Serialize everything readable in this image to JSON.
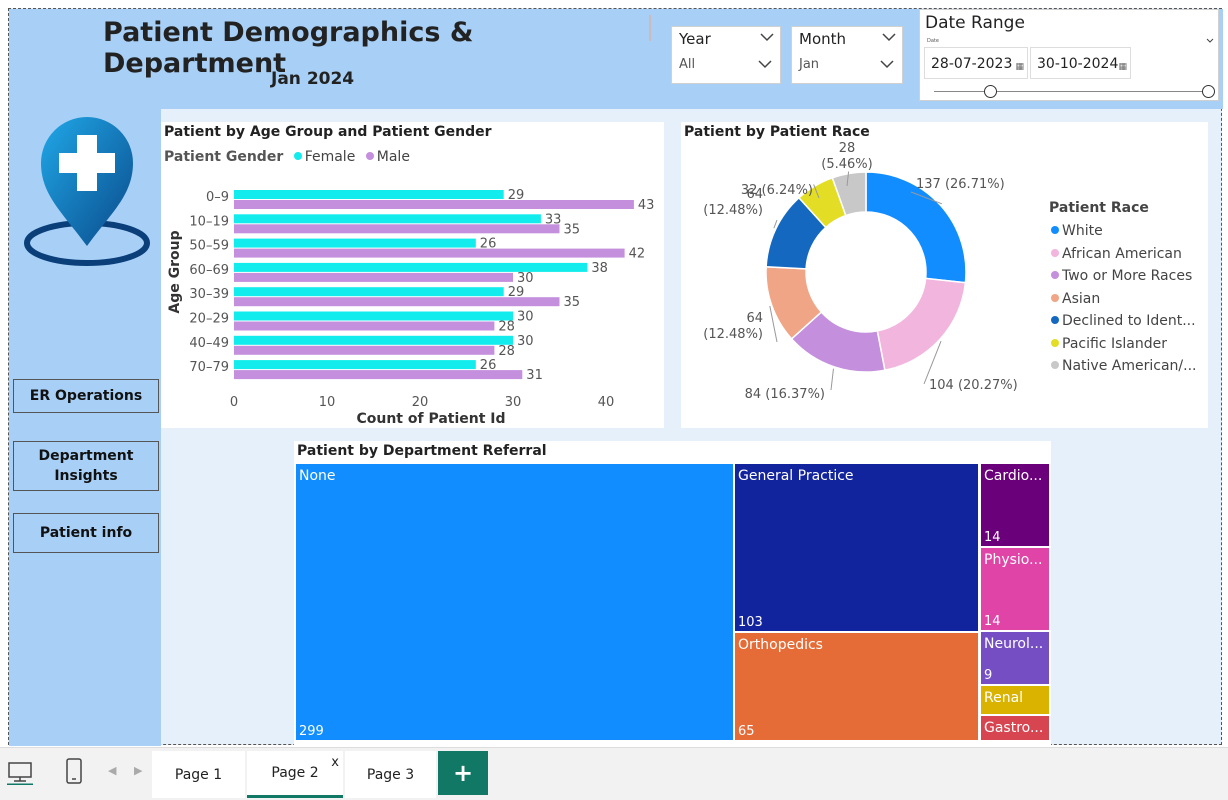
{
  "header": {
    "title": "Patient Demographics & Department",
    "subtitle": "Jan 2024"
  },
  "filters": {
    "year": {
      "label": "Year",
      "value": "All"
    },
    "month": {
      "label": "Month",
      "value": "Jan"
    },
    "date_range": {
      "label": "Date Range",
      "small_label": "Date",
      "start": "28-07-2023",
      "end": "30-10-2024",
      "slider_start": 0.0,
      "slider_end": 1.0
    }
  },
  "nav": {
    "er_operations": "ER Operations",
    "department_insights_line1": "Department",
    "department_insights_line2": "Insights",
    "patient_info": "Patient info"
  },
  "colors": {
    "female": "#12ecec",
    "male": "#c48fdc",
    "header_band": "#a8d0f7"
  },
  "age_chart": {
    "title": "Patient by Age Group and Patient Gender",
    "legend_title": "Patient Gender",
    "female_label": "Female",
    "male_label": "Male"
  },
  "race_chart": {
    "title": "Patient by Patient Race",
    "legend_title": "Patient Race"
  },
  "dept_chart": {
    "title": "Patient by Department Referral"
  },
  "chart_data": [
    {
      "type": "bar",
      "orientation": "horizontal",
      "title": "Patient by Age Group and Patient Gender",
      "xlabel": "Count of Patient Id",
      "ylabel": "Age Group",
      "categories": [
        "0–9",
        "10–19",
        "50–59",
        "60–69",
        "30–39",
        "20–29",
        "40–49",
        "70–79"
      ],
      "series": [
        {
          "name": "Female",
          "values": [
            29,
            33,
            26,
            38,
            29,
            30,
            30,
            26
          ]
        },
        {
          "name": "Male",
          "values": [
            43,
            35,
            42,
            30,
            35,
            28,
            28,
            31
          ]
        }
      ],
      "xlim": [
        0,
        45
      ],
      "xticks": [
        "0",
        "10",
        "20",
        "30",
        "40"
      ],
      "legend_position": "top-left",
      "grid": false
    },
    {
      "type": "pie",
      "variant": "donut",
      "title": "Patient by Patient Race",
      "legend_position": "right",
      "slices": [
        {
          "label": "White",
          "value": 137,
          "label_text": "137 (26.71%)",
          "color": "#118dff"
        },
        {
          "label": "African American",
          "value": 104,
          "label_text": "104 (20.27%)",
          "color": "#f2b5de"
        },
        {
          "label": "Two or More Races",
          "value": 84,
          "label_text": "84 (16.37%)",
          "color": "#c48fdc"
        },
        {
          "label": "Asian",
          "value": 64,
          "label_text_line1": "64",
          "label_text_line2": "(12.48%)",
          "color": "#f0a586"
        },
        {
          "label": "Declined to Ident...",
          "value": 64,
          "label_text_line1": "64",
          "label_text_line2": "(12.48%)",
          "color": "#1568c0"
        },
        {
          "label": "Pacific Islander",
          "value": 32,
          "label_text": "32 (6.24%)",
          "color": "#e3dd25"
        },
        {
          "label": "Native American/...",
          "value": 28,
          "label_text_line1": "28",
          "label_text_line2": "(5.46%)",
          "color": "#c8c8c8"
        }
      ]
    },
    {
      "type": "treemap",
      "title": "Patient by Department Referral",
      "items": [
        {
          "label": "None",
          "value": 299,
          "value_text": "299",
          "color": "#118dff"
        },
        {
          "label": "General Practice",
          "value": 103,
          "value_text": "103",
          "color": "#12239e"
        },
        {
          "label": "Orthopedics",
          "value": 65,
          "value_text": "65",
          "color": "#e66c37"
        },
        {
          "label": "Cardio...",
          "value": 14,
          "value_text": "14",
          "color": "#6b007b"
        },
        {
          "label": "Physio...",
          "value": 14,
          "value_text": "14",
          "color": "#e044a7"
        },
        {
          "label": "Neurol...",
          "value": 9,
          "value_text": "9",
          "color": "#744ec2"
        },
        {
          "label": "Renal",
          "value": 0,
          "value_text": "",
          "color": "#d9b300"
        },
        {
          "label": "Gastro...",
          "value": 0,
          "value_text": "",
          "color": "#d64550"
        }
      ]
    }
  ],
  "pages": {
    "page1": "Page 1",
    "page2": "Page 2",
    "page3": "Page 3",
    "close": "x",
    "add": "+"
  }
}
